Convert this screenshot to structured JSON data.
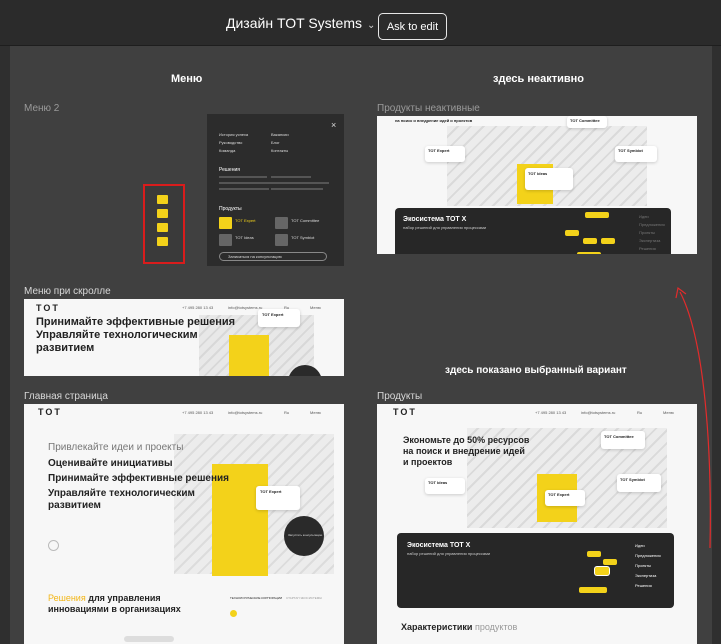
{
  "topbar": {
    "title": "Дизайн TOT Systems",
    "ask_button": "Ask to edit",
    "icons": [
      "chevron-down-icon"
    ]
  },
  "sections": {
    "left_title": "Меню",
    "right_title": "здесь неактивно"
  },
  "frames": {
    "menu2": {
      "label": "Меню 2",
      "close": "×",
      "col1": [
        "История успеха",
        "Руководство",
        "Команда"
      ],
      "col2": [
        "Вакансии",
        "Блог",
        "Контакты"
      ],
      "solutions_title": "Решения",
      "products_title": "Продукты",
      "products": [
        "TOT Expert",
        "TOT Committee",
        "TOT Ideas",
        "TOT Symbiot"
      ],
      "cta": "Записаться на консультацию"
    },
    "scroll_menu": {
      "label": "Меню при скролле",
      "logo": "TOT",
      "phone": "+7 495 280 13 43",
      "email": "info@totsystems.ru",
      "lang": "Ru",
      "menu": "Меню",
      "hero": [
        "Принимайте эффективные решения",
        "Управляйте технологическим",
        "развитием"
      ],
      "card": "TOT Expert"
    },
    "main_page": {
      "label": "Главная страница",
      "logo": "TOT",
      "phone": "+7 495 280 13 43",
      "email": "info@totsystems.ru",
      "lang": "Ru",
      "menu": "Меню",
      "hero_muted": "Привлекайте идеи и проекты",
      "hero": [
        "Оценивайте инициативы",
        "Принимайте эффективные решения",
        "Управляйте технологическим",
        "развитием"
      ],
      "card": "TOT Expert",
      "cta": "Запустить консультацию",
      "solutions_muted": "Решения",
      "solutions": "для управления",
      "solutions2": "инновациями в организациях",
      "tab1": "ТЕХНОЛОГИЧЕСКИЕ КОРПОРАЦИИ",
      "tab2": "СТАРТАП ЭКОСИСТЕМЫ"
    },
    "products_inactive": {
      "label": "Продукты неактивные",
      "intro": "на поиск и внедрение идей и проектов",
      "cards": [
        "TOT Expert",
        "TOT Ideas",
        "TOT Symbiot",
        "TOT Committee"
      ],
      "eco_title": "Экосистема TOT X",
      "eco_sub": "набор решений для управления процессами",
      "nav": [
        "Идеи",
        "Предложения",
        "Проекты",
        "Экспертиза",
        "Решения"
      ]
    },
    "products": {
      "label": "Продукты",
      "logo": "TOT",
      "phone": "+7 495 280 13 43",
      "email": "info@totsystems.ru",
      "lang": "Ru",
      "menu": "Меню",
      "hero": [
        "Экономьте до 50% ресурсов",
        "на поиск и внедрение идей",
        "и проектов"
      ],
      "cards": [
        "TOT Committee",
        "TOT Symbiot",
        "TOT Ideas",
        "TOT Expert"
      ],
      "eco_title": "Экосистема TOT X",
      "eco_sub": "набор решений для управления процессами",
      "nav": [
        "Идеи",
        "Предложения",
        "Проекты",
        "Экспертиза",
        "Решения"
      ],
      "characteristics": "Характеристики",
      "characteristics_muted": "продуктов"
    }
  },
  "notes": {
    "selected": "здесь показано выбранный вариант"
  },
  "colors": {
    "accent": "#f3d21a",
    "highlight": "#d91c1c",
    "canvas": "#404040",
    "topbar": "#2b2b2b"
  }
}
